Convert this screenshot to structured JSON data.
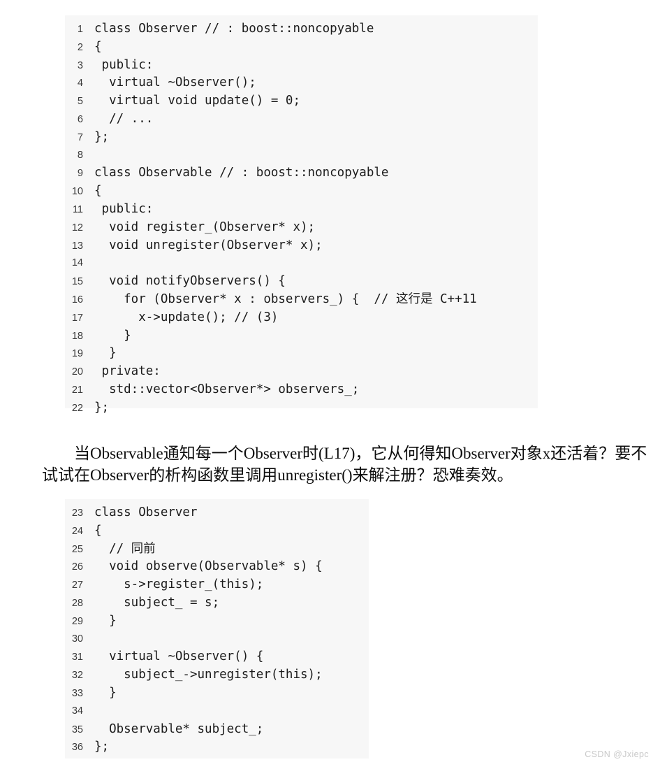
{
  "page": {
    "background_color": "#ffffff",
    "code_background_color": "#f7f7f7",
    "text_color": "#111111",
    "line_number_color": "#3a3a3a",
    "watermark_color": "#c9c9c9"
  },
  "code_block_1": {
    "name": "observer-observable-declaration",
    "lines": [
      {
        "number": "1",
        "text": "class Observer // : boost::noncopyable"
      },
      {
        "number": "2",
        "text": "{"
      },
      {
        "number": "3",
        "text": " public:"
      },
      {
        "number": "4",
        "text": "  virtual ~Observer();"
      },
      {
        "number": "5",
        "text": "  virtual void update() = 0;"
      },
      {
        "number": "6",
        "text": "  // ..."
      },
      {
        "number": "7",
        "text": "};"
      },
      {
        "number": "8",
        "text": ""
      },
      {
        "number": "9",
        "text": "class Observable // : boost::noncopyable"
      },
      {
        "number": "10",
        "text": "{"
      },
      {
        "number": "11",
        "text": " public:"
      },
      {
        "number": "12",
        "text": "  void register_(Observer* x);"
      },
      {
        "number": "13",
        "text": "  void unregister(Observer* x);"
      },
      {
        "number": "14",
        "text": ""
      },
      {
        "number": "15",
        "text": "  void notifyObservers() {"
      },
      {
        "number": "16",
        "text": "    for (Observer* x : observers_) {  // 这行是 C++11"
      },
      {
        "number": "17",
        "text": "      x->update(); // (3)"
      },
      {
        "number": "18",
        "text": "    }"
      },
      {
        "number": "19",
        "text": "  }"
      },
      {
        "number": "20",
        "text": " private:"
      },
      {
        "number": "21",
        "text": "  std::vector<Observer*> observers_;"
      },
      {
        "number": "22",
        "text": "};"
      }
    ]
  },
  "prose": {
    "name": "explanatory-paragraph",
    "text": "当Observable通知每一个Observer时(L17)，它从何得知Observer对象x还活着？要不试试在Observer的析构函数里调用unregister()来解注册？恐难奏效。"
  },
  "code_block_2": {
    "name": "observer-with-subject-pointer",
    "lines": [
      {
        "number": "23",
        "text": "class Observer"
      },
      {
        "number": "24",
        "text": "{"
      },
      {
        "number": "25",
        "text": "  // 同前"
      },
      {
        "number": "26",
        "text": "  void observe(Observable* s) {"
      },
      {
        "number": "27",
        "text": "    s->register_(this);"
      },
      {
        "number": "28",
        "text": "    subject_ = s;"
      },
      {
        "number": "29",
        "text": "  }"
      },
      {
        "number": "30",
        "text": ""
      },
      {
        "number": "31",
        "text": "  virtual ~Observer() {"
      },
      {
        "number": "32",
        "text": "    subject_->unregister(this);"
      },
      {
        "number": "33",
        "text": "  }"
      },
      {
        "number": "34",
        "text": ""
      },
      {
        "number": "35",
        "text": "  Observable* subject_;"
      },
      {
        "number": "36",
        "text": "};"
      }
    ]
  },
  "watermark": {
    "text": "CSDN @Jxiepc"
  }
}
